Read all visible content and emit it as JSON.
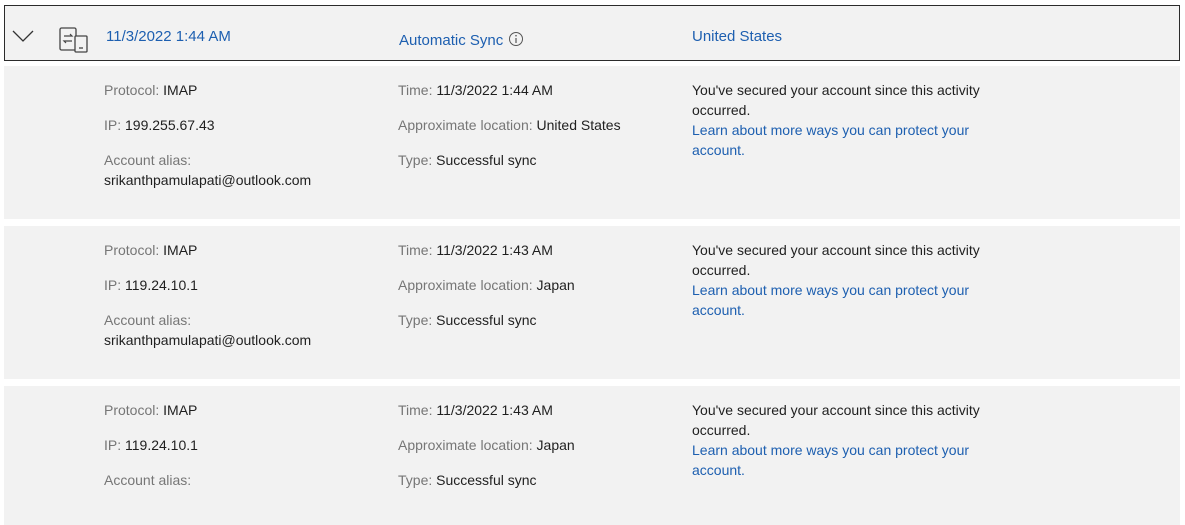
{
  "header": {
    "date": "11/3/2022 1:44 AM",
    "activity_type": "Automatic Sync",
    "location": "United States",
    "icons": {
      "expand": "chevron-down-icon",
      "device": "device-sync-icon",
      "info": "info-icon"
    }
  },
  "labels": {
    "protocol": "Protocol:",
    "ip": "IP:",
    "alias": "Account alias:",
    "time": "Time:",
    "location": "Approximate location:",
    "type": "Type:"
  },
  "records": [
    {
      "protocol": "IMAP",
      "ip": "199.255.67.43",
      "alias": "srikanthpamulapati@outlook.com",
      "time": "11/3/2022 1:44 AM",
      "location": "United States",
      "type": "Successful sync",
      "note": "You've secured your account since this activity occurred.",
      "link": "Learn about more ways you can protect your account."
    },
    {
      "protocol": "IMAP",
      "ip": "119.24.10.1",
      "alias": "srikanthpamulapati@outlook.com",
      "time": "11/3/2022 1:43 AM",
      "location": "Japan",
      "type": "Successful sync",
      "note": "You've secured your account since this activity occurred.",
      "link": "Learn about more ways you can protect your account."
    },
    {
      "protocol": "IMAP",
      "ip": "119.24.10.1",
      "alias": "",
      "time": "11/3/2022 1:43 AM",
      "location": "Japan",
      "type": "Successful sync",
      "note": "You've secured your account since this activity occurred.",
      "link": "Learn about more ways you can protect your account."
    }
  ],
  "colors": {
    "accent": "#1d5fb0",
    "card_bg": "#f2f2f2",
    "label": "#767676"
  }
}
